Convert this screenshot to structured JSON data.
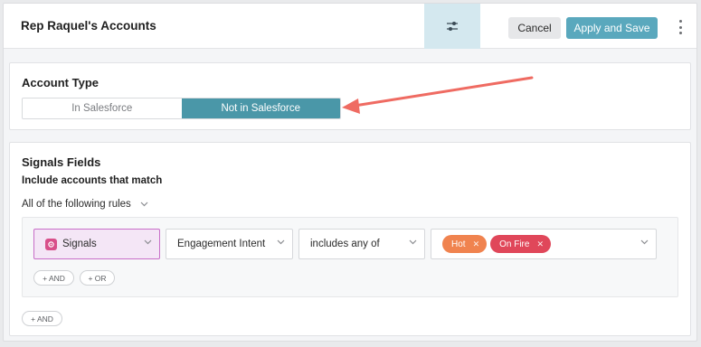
{
  "header": {
    "title": "Rep Raquel's Accounts",
    "cancel_label": "Cancel",
    "save_label": "Apply and Save"
  },
  "account_type": {
    "title": "Account Type",
    "options": [
      "In Salesforce",
      "Not in Salesforce"
    ],
    "selected": "Not in Salesforce"
  },
  "signals_fields": {
    "title": "Signals Fields",
    "include_label": "Include accounts that match",
    "match_mode": "All of the following rules",
    "rule": {
      "source": "Signals",
      "field": "Engagement Intent",
      "operator": "includes any of",
      "values": [
        "Hot",
        "On Fire"
      ]
    },
    "inner_and_label": "+ AND",
    "inner_or_label": "+ OR",
    "outer_and_label": "+ AND"
  },
  "colors": {
    "accent": "#5aa8bd",
    "selected_segment": "#4a97a8",
    "chip_hot": "#f0834f",
    "chip_on_fire": "#e0475a",
    "annotation_arrow": "#ef6b62"
  }
}
